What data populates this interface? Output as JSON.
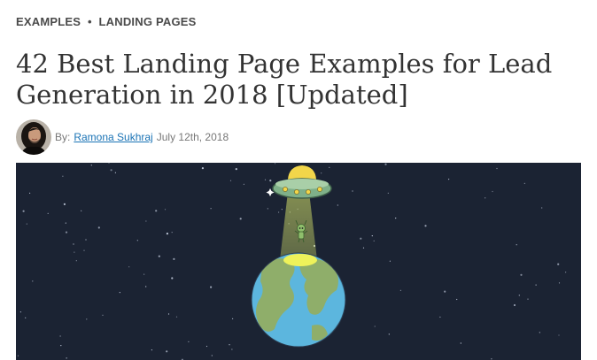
{
  "breadcrumb": {
    "category": "EXAMPLES",
    "separator": "•",
    "subcategory": "LANDING PAGES"
  },
  "article": {
    "title": "42 Best Landing Page Examples for Lead Generation in 2018 [Updated]",
    "byline": {
      "prefix": "By:",
      "author": "Ramona Sukhraj",
      "date": "July 12th, 2018"
    }
  },
  "colors": {
    "hero_background": "#1b2333",
    "link": "#1a73b5",
    "ufo_body": "#7fb089",
    "ufo_dome": "#f2d64a",
    "beam": "#d9e66b",
    "earth_water": "#5cb6de",
    "earth_land": "#8fae6a"
  },
  "icons": {
    "avatar": "author-avatar",
    "hero": "ufo-earth-illustration"
  }
}
